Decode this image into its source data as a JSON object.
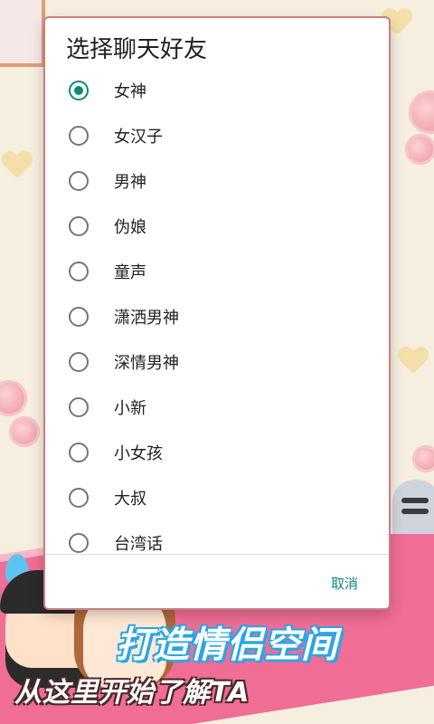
{
  "dialog": {
    "title": "选择聊天好友",
    "selected_index": 0,
    "options": [
      {
        "label": "女神",
        "checked": true
      },
      {
        "label": "女汉子",
        "checked": false
      },
      {
        "label": "男神",
        "checked": false
      },
      {
        "label": "伪娘",
        "checked": false
      },
      {
        "label": "童声",
        "checked": false
      },
      {
        "label": "潇洒男神",
        "checked": false
      },
      {
        "label": "深情男神",
        "checked": false
      },
      {
        "label": "小新",
        "checked": false
      },
      {
        "label": "小女孩",
        "checked": false
      },
      {
        "label": "大叔",
        "checked": false
      },
      {
        "label": "台湾话",
        "checked": false
      }
    ],
    "cancel_label": "取消"
  },
  "banner": {
    "slogan_main": "打造情侣空间",
    "slogan_sub": "从这里开始了解TA"
  },
  "colors": {
    "accent": "#0b8a76",
    "banner_pink": "#f06d95",
    "background": "#f6eedf"
  }
}
